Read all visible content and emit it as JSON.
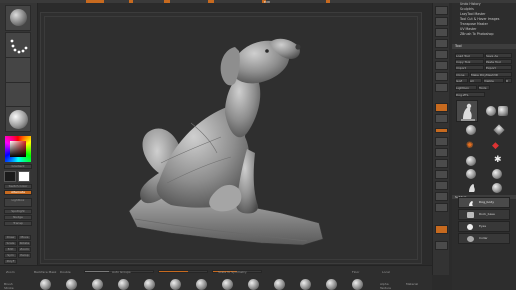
{
  "top_bar": {
    "label": "Edit"
  },
  "left_panel": {
    "buttons": [
      "Gradient",
      "Switch Color",
      "Alternate",
      "Lightbox",
      "Spotlight",
      "Nudge",
      "Transp",
      "Draw",
      "Move",
      "Scale",
      "Rotate",
      "Edit",
      "Zoom",
      "Sym",
      "Persp",
      "PolyF"
    ],
    "color_swatch_front": "#1a1a1a",
    "color_swatch_back": "#ffffff"
  },
  "right_menu": {
    "items": [
      "Undo History",
      "Sculptris",
      "LazyTool Master",
      "Tool Cut & Hover Images",
      "Transpose Master",
      "UV Master",
      "ZBrush To Photoshop"
    ],
    "tool_header": "Tool",
    "tool_buttons": [
      "Load Tool",
      "Save As",
      "Copy Tool",
      "Paste Tool",
      "Import",
      "Export",
      "Clone",
      "Make PolyMesh3D",
      "GoZ",
      "All",
      "Visible",
      "R",
      "Lightbox",
      "Tools",
      "Dog.ZTL"
    ],
    "subtool_label": "Subtool",
    "subtools": [
      "Dog_body",
      "Rock_base",
      "Eyes",
      "Collar"
    ]
  },
  "bottom_bar": {
    "labels": [
      "Zoom",
      "Backface Mask",
      "Double",
      "Auto Groups",
      "Scale To Symmetry",
      "Floor",
      "Local",
      "Brush",
      "Stroke",
      "Alpha",
      "Texture",
      "Material"
    ],
    "slider_values": [
      0.35,
      0.6,
      0.5
    ]
  },
  "colors": {
    "accent": "#c76a1f",
    "background": "#2b2b2b",
    "viewport": "#2f2f2f"
  }
}
